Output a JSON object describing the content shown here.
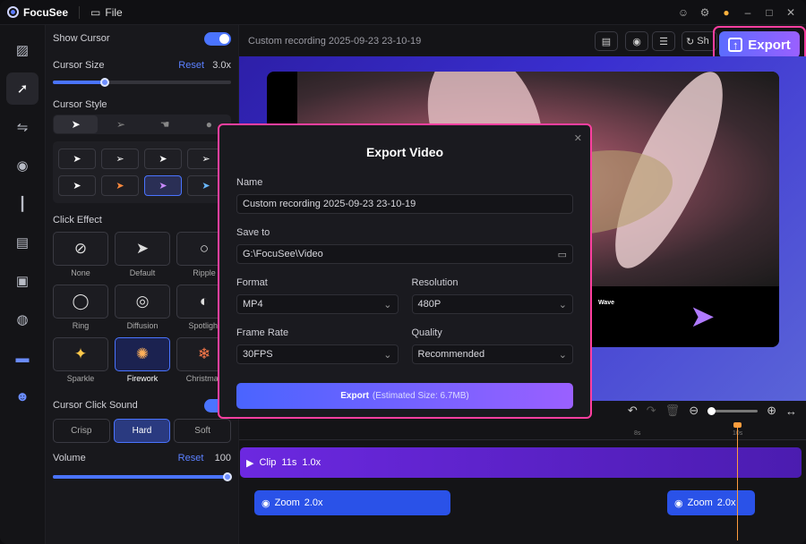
{
  "app": {
    "name": "FocuSee",
    "file_menu": "File"
  },
  "titlebar_icons": [
    "feedback-icon",
    "settings-icon",
    "upgrade-icon",
    "minimize-icon",
    "maximize-icon",
    "close-icon"
  ],
  "rail": {
    "items": [
      "background-icon",
      "cursor-icon",
      "path-icon",
      "camera-icon",
      "audio-icon",
      "captions-icon",
      "frame-icon",
      "effects-icon",
      "watermark-icon",
      "avatar-icon"
    ]
  },
  "panel": {
    "show_cursor": "Show Cursor",
    "cursor_size": {
      "label": "Cursor Size",
      "reset": "Reset",
      "value": "3.0x",
      "level": 0.22
    },
    "cursor_style": "Cursor Style",
    "click_effect": "Click Effect",
    "effects": [
      "None",
      "Default",
      "Ripple",
      "Ring",
      "Diffusion",
      "Spotlight",
      "Sparkle",
      "Firework",
      "Christmas"
    ],
    "click_sound": "Cursor Click Sound",
    "sounds": [
      "Crisp",
      "Hard",
      "Soft"
    ],
    "volume": {
      "label": "Volume",
      "reset": "Reset",
      "value": "100",
      "level": 1.0
    }
  },
  "main": {
    "recording_title": "Custom recording 2025-09-23 23-10-19",
    "export_label": "Export",
    "share_label": "Sh",
    "video_caption": "Wave"
  },
  "timeline": {
    "ruler": [
      "8s",
      "10s"
    ],
    "clip": {
      "label": "Clip",
      "duration": "11s",
      "speed": "1.0x"
    },
    "zooms": [
      {
        "label": "Zoom",
        "value": "2.0x"
      },
      {
        "label": "Zoom",
        "value": "2.0x"
      }
    ]
  },
  "dialog": {
    "title": "Export Video",
    "name_label": "Name",
    "name_value": "Custom recording 2025-09-23 23-10-19",
    "save_label": "Save to",
    "save_value": "G:\\FocuSee\\Video",
    "format_label": "Format",
    "format_value": "MP4",
    "resolution_label": "Resolution",
    "resolution_value": "480P",
    "framerate_label": "Frame Rate",
    "framerate_value": "30FPS",
    "quality_label": "Quality",
    "quality_value": "Recommended",
    "export_label": "Export",
    "estimated_size": "(Estimated Size: 6.7MB)"
  },
  "colors": {
    "accent": "#4a74ff",
    "highlight": "#ff3fa0",
    "clip": "#6c28e0",
    "zoom": "#2a52e8",
    "playhead": "#ff9d3d"
  }
}
